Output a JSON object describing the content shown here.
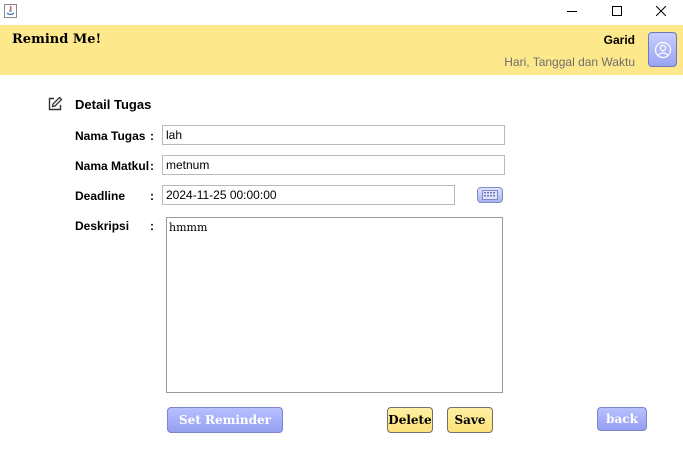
{
  "window": {
    "minimize_glyph": "—",
    "maximize_glyph": "☐",
    "close_glyph": "✕"
  },
  "header": {
    "app_title": "Remind Me!",
    "username": "Garid",
    "datetime": "Hari, Tanggal dan Waktu"
  },
  "form": {
    "section_title": "Detail Tugas",
    "fields": {
      "nama_tugas": {
        "label": "Nama Tugas",
        "value": "lah"
      },
      "nama_matkul": {
        "label": "Nama Matkul",
        "value": "metnum"
      },
      "deadline": {
        "label": "Deadline",
        "value": "2024-11-25 00:00:00"
      },
      "deskripsi": {
        "label": "Deskripsi",
        "value": "hmmm"
      }
    },
    "colon": ":"
  },
  "buttons": {
    "set_reminder": "Set Reminder",
    "delete": "Delete",
    "save": "Save",
    "back": "back"
  },
  "icons": {
    "app": "java-app-icon",
    "profile": "user-profile-icon",
    "edit": "edit-icon",
    "calendar": "calendar-icon"
  },
  "colors": {
    "header_bg": "#fde98c",
    "blue_button": "#9aa4f1",
    "yellow_button": "#fde27a"
  }
}
